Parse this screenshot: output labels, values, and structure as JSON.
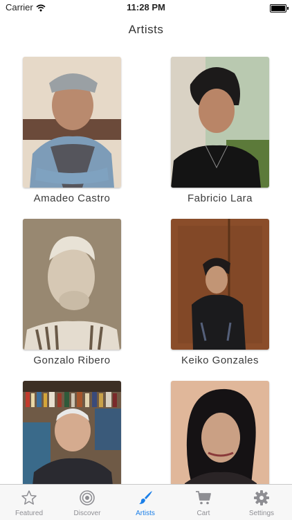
{
  "status_bar": {
    "carrier": "Carrier",
    "time": "11:28 PM"
  },
  "nav": {
    "title": "Artists"
  },
  "artists": [
    {
      "name": "Amadeo Castro"
    },
    {
      "name": "Fabricio Lara"
    },
    {
      "name": "Gonzalo Ribero"
    },
    {
      "name": "Keiko Gonzales"
    },
    {
      "name": ""
    },
    {
      "name": ""
    }
  ],
  "tabs": [
    {
      "label": "Featured",
      "icon": "star-icon"
    },
    {
      "label": "Discover",
      "icon": "target-icon"
    },
    {
      "label": "Artists",
      "icon": "brush-icon",
      "active": true
    },
    {
      "label": "Cart",
      "icon": "cart-icon"
    },
    {
      "label": "Settings",
      "icon": "gear-icon"
    }
  ],
  "colors": {
    "accent": "#1a7fe8",
    "inactive": "#8e8e93"
  }
}
